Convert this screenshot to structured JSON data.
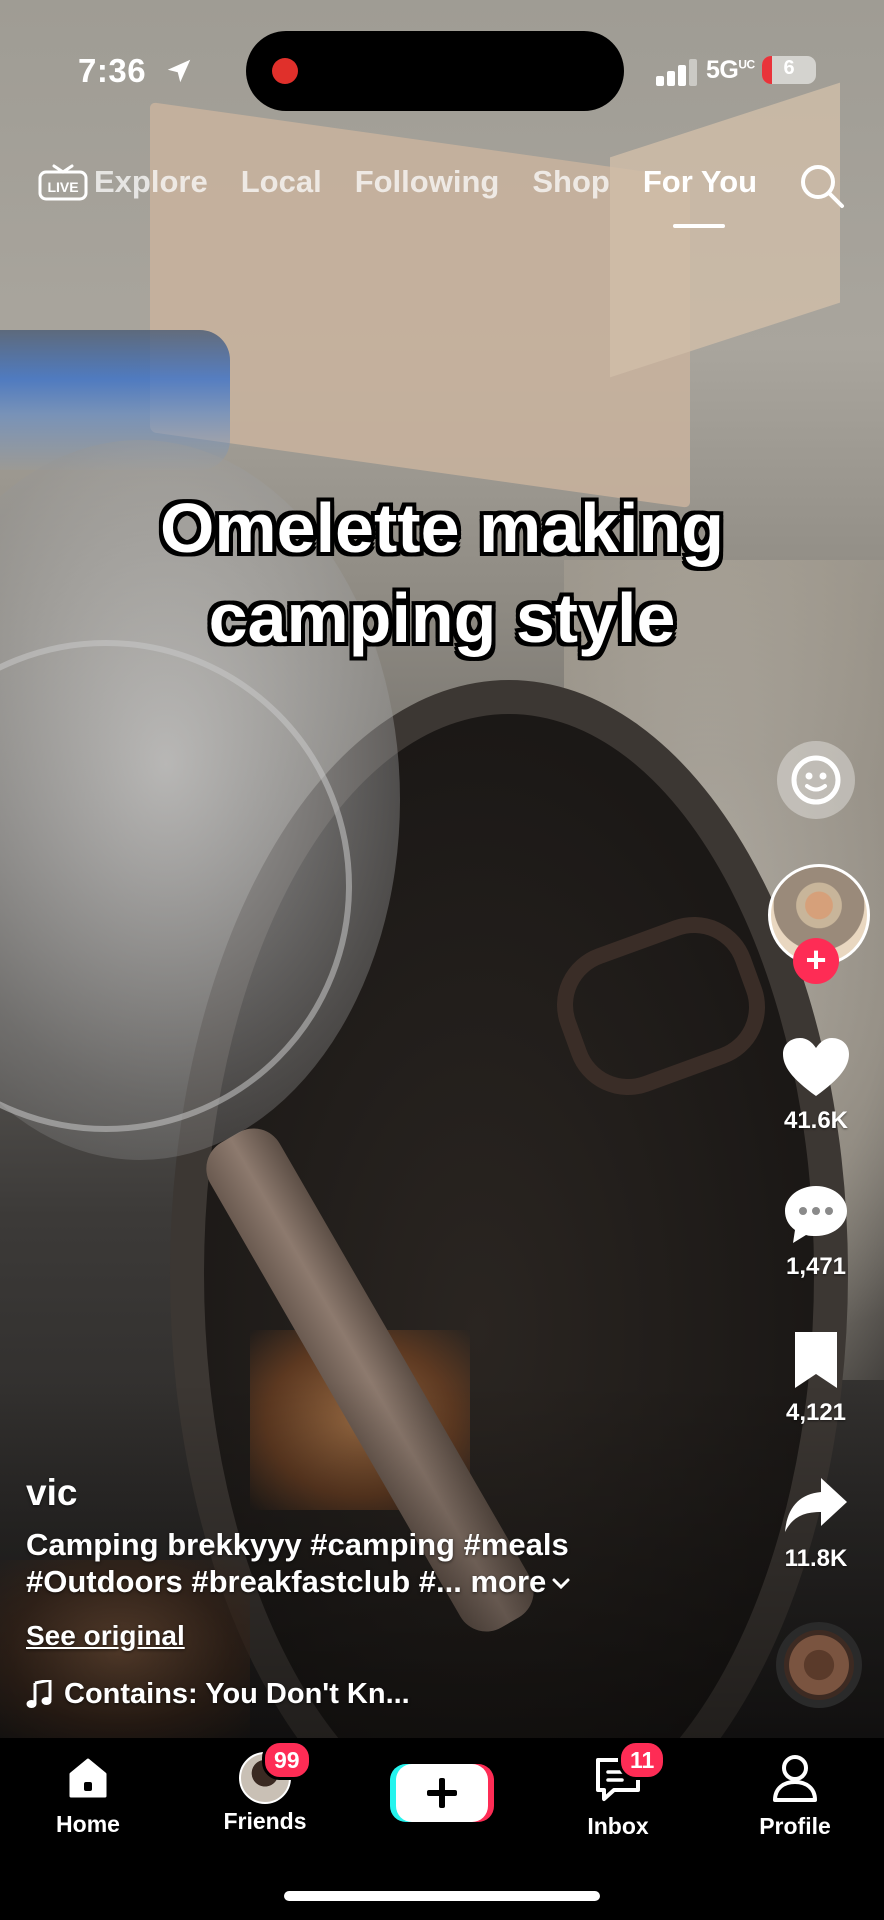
{
  "status_bar": {
    "time": "7:36",
    "network": "5G",
    "network_suffix": "UC",
    "battery": "6"
  },
  "top_nav": {
    "live_label": "LIVE",
    "tabs": [
      {
        "label": "Explore",
        "active": false
      },
      {
        "label": "Local",
        "active": false
      },
      {
        "label": "Following",
        "active": false
      },
      {
        "label": "Shop",
        "active": false
      },
      {
        "label": "For You",
        "active": true
      }
    ]
  },
  "video": {
    "overlay_text_line1": "Omelette making",
    "overlay_text_line2": "camping style"
  },
  "rail": {
    "likes": "41.6K",
    "comments": "1,471",
    "saves": "4,121",
    "shares": "11.8K"
  },
  "post": {
    "username": "vic",
    "caption_line1": "Camping brekkyyy #camping #meals",
    "caption_line2": "#Outdoors #breakfastclub #...",
    "more_label": "more",
    "see_original": "See original",
    "sound": "Contains: You Don't Kn..."
  },
  "tabbar": {
    "home": "Home",
    "friends": "Friends",
    "friends_badge": "99",
    "inbox": "Inbox",
    "inbox_badge": "11",
    "profile": "Profile"
  },
  "colors": {
    "accent": "#fe2c55",
    "tabbar_bg": "#000000"
  }
}
